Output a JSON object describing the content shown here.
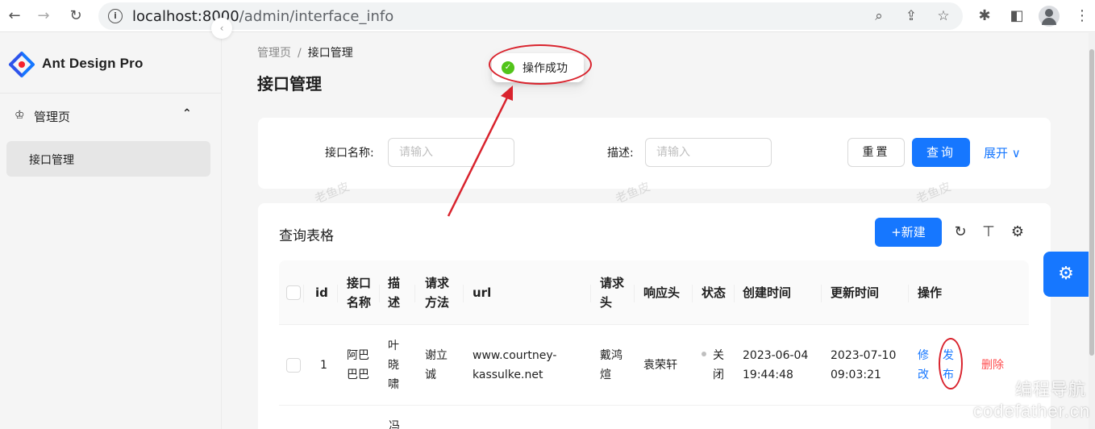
{
  "browser": {
    "url_host": "localhost:8000",
    "url_path": "/admin/interface_info",
    "icons": {
      "back": "arrow-left-icon",
      "forward": "arrow-right-icon",
      "reload": "reload-icon",
      "info": "info-icon",
      "zoom": "zoom-icon",
      "share": "share-icon",
      "bookmark": "star-icon",
      "extensions": "puzzle-icon",
      "sidepanel": "sidepanel-icon",
      "profile": "profile-icon",
      "menu": "kebab-menu-icon"
    }
  },
  "sidebar": {
    "brand": "Ant Design Pro",
    "group_label": "管理页",
    "items": [
      {
        "label": "接口管理"
      }
    ]
  },
  "breadcrumb": {
    "root": "管理页",
    "current": "接口管理"
  },
  "page_title": "接口管理",
  "toast": {
    "message": "操作成功"
  },
  "search": {
    "name_label": "接口名称:",
    "name_placeholder": "请输入",
    "desc_label": "描述:",
    "desc_placeholder": "请输入",
    "reset_label": "重置",
    "query_label": "查询",
    "expand_label": "展开"
  },
  "watermark": "老鱼皮",
  "table": {
    "title": "查询表格",
    "new_label": "+新建",
    "headers": {
      "id": "id",
      "name": [
        "接口",
        "名称"
      ],
      "desc": [
        "描",
        "述"
      ],
      "method": [
        "请求",
        "方法"
      ],
      "url": "url",
      "req_header": [
        "请求",
        "头"
      ],
      "resp_header": "响应头",
      "status": "状态",
      "created": "创建时间",
      "updated": "更新时间",
      "actions": "操作"
    },
    "rows": [
      {
        "id": "1",
        "name": [
          "阿巴",
          "巴巴"
        ],
        "desc": [
          "叶",
          "晓",
          "啸"
        ],
        "method": [
          "谢立",
          "诚"
        ],
        "url": [
          "www.courtney-",
          "kassulke.net"
        ],
        "req_header": [
          "戴鸿",
          "煊"
        ],
        "resp_header": "袁荣轩",
        "status": [
          "关",
          "闭"
        ],
        "created": [
          "2023-06-04",
          "19:44:48"
        ],
        "updated": [
          "2023-07-10",
          "09:03:21"
        ],
        "edit": [
          "修",
          "改"
        ],
        "publish": [
          "发",
          "布"
        ],
        "delete": "删除"
      }
    ],
    "next_row_peek": "冯"
  },
  "corner_watermark": {
    "line1": "编程导航",
    "line2": "codefather.cn"
  },
  "colors": {
    "primary": "#1677ff",
    "danger": "#ff4d4f",
    "success": "#52c41a",
    "annotation": "#d9232d"
  }
}
